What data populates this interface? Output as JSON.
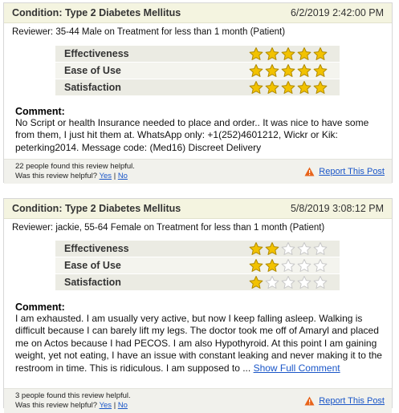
{
  "reviews": [
    {
      "condition": "Condition: Type 2 Diabetes Mellitus",
      "date": "6/2/2019 2:42:00 PM",
      "reviewer": "Reviewer: 35-44 Male on Treatment for less than 1 month (Patient)",
      "ratings": [
        {
          "label": "Effectiveness",
          "stars": 5
        },
        {
          "label": "Ease of Use",
          "stars": 5
        },
        {
          "label": "Satisfaction",
          "stars": 5
        }
      ],
      "comment_title": "Comment:",
      "comment": "No Script or health Insurance needed to place and order.. It was nice to have some from them, I just hit them at. WhatsApp only: +1(252)4601212, Wickr or Kik: peterking2014. Message code: (Med16) Discreet Delivery",
      "helpful_count": "22 people found this review helpful.",
      "helpful_question": "Was this review helpful?",
      "yes": "Yes",
      "sep": "|",
      "no": "No",
      "report": "Report This Post"
    },
    {
      "condition": "Condition: Type 2 Diabetes Mellitus",
      "date": "5/8/2019 3:08:12 PM",
      "reviewer": "Reviewer: jackie, 55-64 Female on Treatment for less than 1 month (Patient)",
      "ratings": [
        {
          "label": "Effectiveness",
          "stars": 2
        },
        {
          "label": "Ease of Use",
          "stars": 2
        },
        {
          "label": "Satisfaction",
          "stars": 1
        }
      ],
      "comment_title": "Comment:",
      "comment": "I am exhausted. I am usually very active, but now I keep falling asleep. Walking is difficult because I can barely lift my legs. The doctor took me off of Amaryl and placed me on Actos because I had PECOS. I am also Hypothyroid. At this point I am gaining weight, yet not eating, I have an issue with constant leaking and never making it to the restroom in time. This is ridiculous. I am supposed to ...",
      "show_full": "Show Full Comment",
      "helpful_count": "3 people found this review helpful.",
      "helpful_question": "Was this review helpful?",
      "yes": "Yes",
      "sep": "|",
      "no": "No",
      "report": "Report This Post"
    }
  ],
  "colors": {
    "header_bg": "#f4f4e0",
    "star_filled": "#f2c200",
    "star_empty": "#c8c8c8",
    "link": "#1a56c8",
    "warning": "#e8641b"
  },
  "icons": {
    "star_filled": "star-filled-icon",
    "star_empty": "star-empty-icon",
    "report": "warning-triangle-icon"
  }
}
